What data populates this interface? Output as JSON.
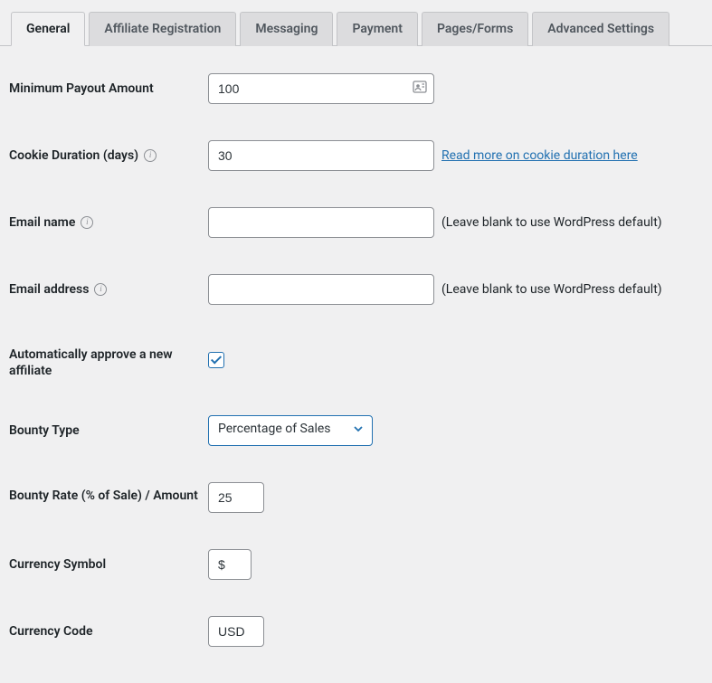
{
  "tabs": {
    "general": "General",
    "affiliate_registration": "Affiliate Registration",
    "messaging": "Messaging",
    "payment": "Payment",
    "pages_forms": "Pages/Forms",
    "advanced_settings": "Advanced Settings"
  },
  "labels": {
    "min_payout": "Minimum Payout Amount",
    "cookie_duration": "Cookie Duration (days)",
    "email_name": "Email name",
    "email_address": "Email address",
    "auto_approve": "Automatically approve a new affiliate",
    "bounty_type": "Bounty Type",
    "bounty_rate": "Bounty Rate (% of Sale) / Amount",
    "currency_symbol": "Currency Symbol",
    "currency_code": "Currency Code"
  },
  "values": {
    "min_payout": "100",
    "cookie_duration": "30",
    "email_name": "",
    "email_address": "",
    "auto_approve": true,
    "bounty_type": "Percentage of Sales",
    "bounty_rate": "25",
    "currency_symbol": "$",
    "currency_code": "USD"
  },
  "hints": {
    "cookie_link": "Read more on cookie duration here",
    "wp_default": "(Leave blank to use WordPress default)"
  }
}
